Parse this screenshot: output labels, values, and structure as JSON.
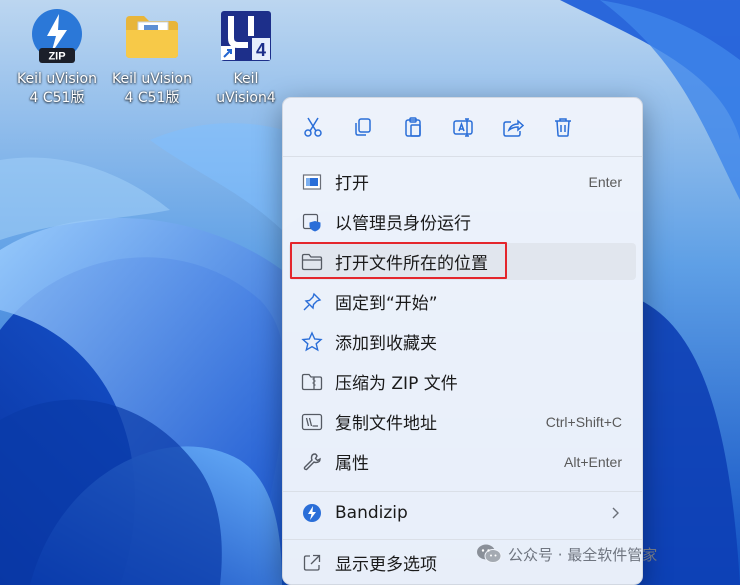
{
  "desktop": {
    "icons": [
      {
        "name_line1": "Keil uVision",
        "name_line2": "4 C51版"
      },
      {
        "name_line1": "Keil uVision",
        "name_line2": "4 C51版"
      },
      {
        "name_line1": "Keil",
        "name_line2": "uVision4"
      }
    ],
    "zip_badge": "ZIP",
    "uv_badge": "4"
  },
  "context_menu": {
    "toolbar": [
      "cut",
      "copy",
      "paste",
      "rename",
      "share",
      "delete"
    ],
    "items": [
      {
        "label": "打开",
        "shortcut": "Enter",
        "icon": "app-window-icon"
      },
      {
        "label": "以管理员身份运行",
        "shortcut": "",
        "icon": "shield-window-icon"
      },
      {
        "label": "打开文件所在的位置",
        "shortcut": "",
        "icon": "folder-icon",
        "highlighted": true
      },
      {
        "label": "固定到“开始”",
        "shortcut": "",
        "icon": "pin-icon"
      },
      {
        "label": "添加到收藏夹",
        "shortcut": "",
        "icon": "star-icon"
      },
      {
        "label": "压缩为 ZIP 文件",
        "shortcut": "",
        "icon": "zip-folder-icon"
      },
      {
        "label": "复制文件地址",
        "shortcut": "Ctrl+Shift+C",
        "icon": "copy-path-icon"
      },
      {
        "label": "属性",
        "shortcut": "Alt+Enter",
        "icon": "wrench-icon"
      }
    ],
    "bandizip": {
      "label": "Bandizip",
      "icon": "bandizip-icon"
    },
    "more": {
      "label": "显示更多选项",
      "icon": "open-external-icon"
    }
  },
  "watermark": {
    "text": "公众号 · 最全软件管家"
  },
  "colors": {
    "accent": "#2a6ed8",
    "highlight_border": "#e4262c",
    "menu_bg": "#f0f4fb"
  }
}
